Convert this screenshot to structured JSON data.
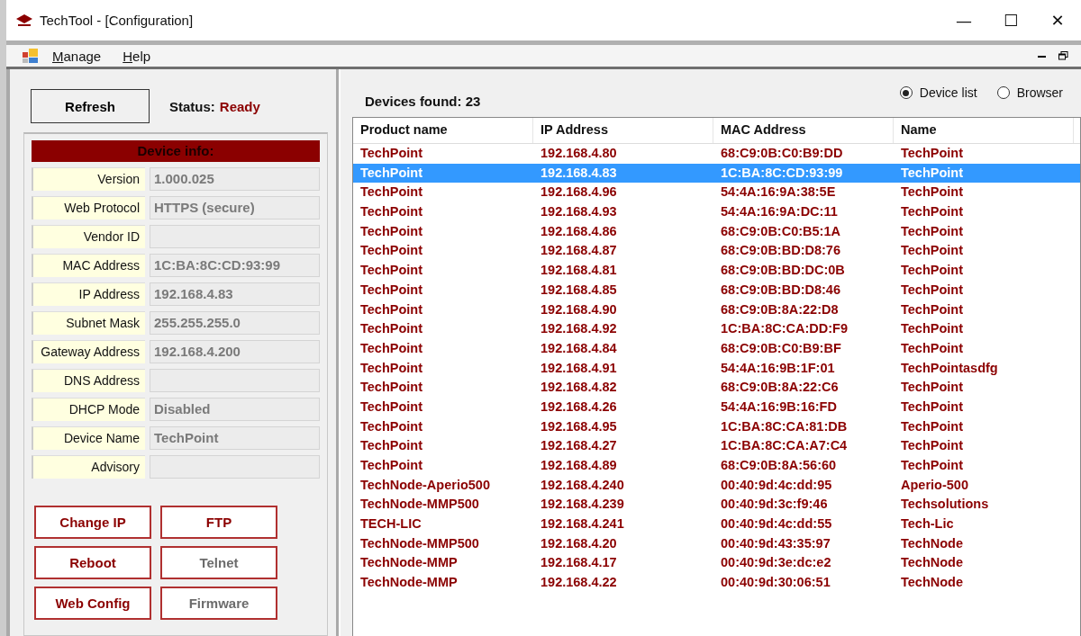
{
  "window": {
    "title": "TechTool - [Configuration]",
    "controls": [
      "—",
      "☐",
      "✕"
    ]
  },
  "menu": [
    "Manage",
    "Help"
  ],
  "refresh_button": "Refresh",
  "status": {
    "label": "Status:",
    "value": "Ready"
  },
  "device_info": {
    "title": "Device info:",
    "fields": [
      {
        "label": "Version",
        "value": "1.000.025"
      },
      {
        "label": "Web Protocol",
        "value": "HTTPS (secure)"
      },
      {
        "label": "Vendor ID"
      },
      {
        "label": "MAC Address",
        "value": "1C:BA:8C:CD:93:99"
      },
      {
        "label": "IP Address",
        "value": "192.168.4.83"
      },
      {
        "label": "Subnet Mask",
        "value": "255.255.255.0"
      },
      {
        "label": "Gateway Address",
        "value": "192.168.4.200"
      },
      {
        "label": "DNS Address"
      },
      {
        "label": "DHCP Mode",
        "value": "Disabled"
      },
      {
        "label": "Device Name",
        "value": "TechPoint"
      },
      {
        "label": "Advisory"
      }
    ]
  },
  "actions": [
    {
      "label": "Change IP",
      "disabled": false
    },
    {
      "label": "FTP",
      "disabled": false
    },
    {
      "label": "Reboot",
      "disabled": false
    },
    {
      "label": "Telnet",
      "disabled": true
    },
    {
      "label": "Web Config",
      "disabled": false
    },
    {
      "label": "Firmware",
      "disabled": true
    }
  ],
  "devices_found": "Devices found: 23",
  "view_options": [
    {
      "label": "Device list",
      "selected": true
    },
    {
      "label": "Browser",
      "selected": false
    }
  ],
  "table": {
    "columns": [
      "Product name",
      "IP Address",
      "MAC Address",
      "Name"
    ],
    "rows": [
      {
        "cells": [
          "TechPoint",
          "192.168.4.80",
          "68:C9:0B:C0:B9:DD",
          "TechPoint"
        ],
        "selected": false
      },
      {
        "cells": [
          "TechPoint",
          "192.168.4.83",
          "1C:BA:8C:CD:93:99",
          "TechPoint"
        ],
        "selected": true
      },
      {
        "cells": [
          "TechPoint",
          "192.168.4.96",
          "54:4A:16:9A:38:5E",
          "TechPoint"
        ],
        "selected": false
      },
      {
        "cells": [
          "TechPoint",
          "192.168.4.93",
          "54:4A:16:9A:DC:11",
          "TechPoint"
        ],
        "selected": false
      },
      {
        "cells": [
          "TechPoint",
          "192.168.4.86",
          "68:C9:0B:C0:B5:1A",
          "TechPoint"
        ],
        "selected": false
      },
      {
        "cells": [
          "TechPoint",
          "192.168.4.87",
          "68:C9:0B:BD:D8:76",
          "TechPoint"
        ],
        "selected": false
      },
      {
        "cells": [
          "TechPoint",
          "192.168.4.81",
          "68:C9:0B:BD:DC:0B",
          "TechPoint"
        ],
        "selected": false
      },
      {
        "cells": [
          "TechPoint",
          "192.168.4.85",
          "68:C9:0B:BD:D8:46",
          "TechPoint"
        ],
        "selected": false
      },
      {
        "cells": [
          "TechPoint",
          "192.168.4.90",
          "68:C9:0B:8A:22:D8",
          "TechPoint"
        ],
        "selected": false
      },
      {
        "cells": [
          "TechPoint",
          "192.168.4.92",
          "1C:BA:8C:CA:DD:F9",
          "TechPoint"
        ],
        "selected": false
      },
      {
        "cells": [
          "TechPoint",
          "192.168.4.84",
          "68:C9:0B:C0:B9:BF",
          "TechPoint"
        ],
        "selected": false
      },
      {
        "cells": [
          "TechPoint",
          "192.168.4.91",
          "54:4A:16:9B:1F:01",
          "TechPointasdfg"
        ],
        "selected": false
      },
      {
        "cells": [
          "TechPoint",
          "192.168.4.82",
          "68:C9:0B:8A:22:C6",
          "TechPoint"
        ],
        "selected": false
      },
      {
        "cells": [
          "TechPoint",
          "192.168.4.26",
          "54:4A:16:9B:16:FD",
          "TechPoint"
        ],
        "selected": false
      },
      {
        "cells": [
          "TechPoint",
          "192.168.4.95",
          "1C:BA:8C:CA:81:DB",
          "TechPoint"
        ],
        "selected": false
      },
      {
        "cells": [
          "TechPoint",
          "192.168.4.27",
          "1C:BA:8C:CA:A7:C4",
          "TechPoint"
        ],
        "selected": false
      },
      {
        "cells": [
          "TechPoint",
          "192.168.4.89",
          "68:C9:0B:8A:56:60",
          "TechPoint"
        ],
        "selected": false
      },
      {
        "cells": [
          "TechNode-Aperio500",
          "192.168.4.240",
          "00:40:9d:4c:dd:95",
          "Aperio-500"
        ],
        "selected": false
      },
      {
        "cells": [
          "TechNode-MMP500",
          "192.168.4.239",
          "00:40:9d:3c:f9:46",
          "Techsolutions"
        ],
        "selected": false
      },
      {
        "cells": [
          "TECH-LIC",
          "192.168.4.241",
          "00:40:9d:4c:dd:55",
          "Tech-Lic"
        ],
        "selected": false
      },
      {
        "cells": [
          "TechNode-MMP500",
          "192.168.4.20",
          "00:40:9d:43:35:97",
          "TechNode"
        ],
        "selected": false
      },
      {
        "cells": [
          "TechNode-MMP",
          "192.168.4.17",
          "00:40:9d:3e:dc:e2",
          "TechNode"
        ],
        "selected": false
      },
      {
        "cells": [
          "TechNode-MMP",
          "192.168.4.22",
          "00:40:9d:30:06:51",
          "TechNode"
        ],
        "selected": false
      }
    ]
  }
}
